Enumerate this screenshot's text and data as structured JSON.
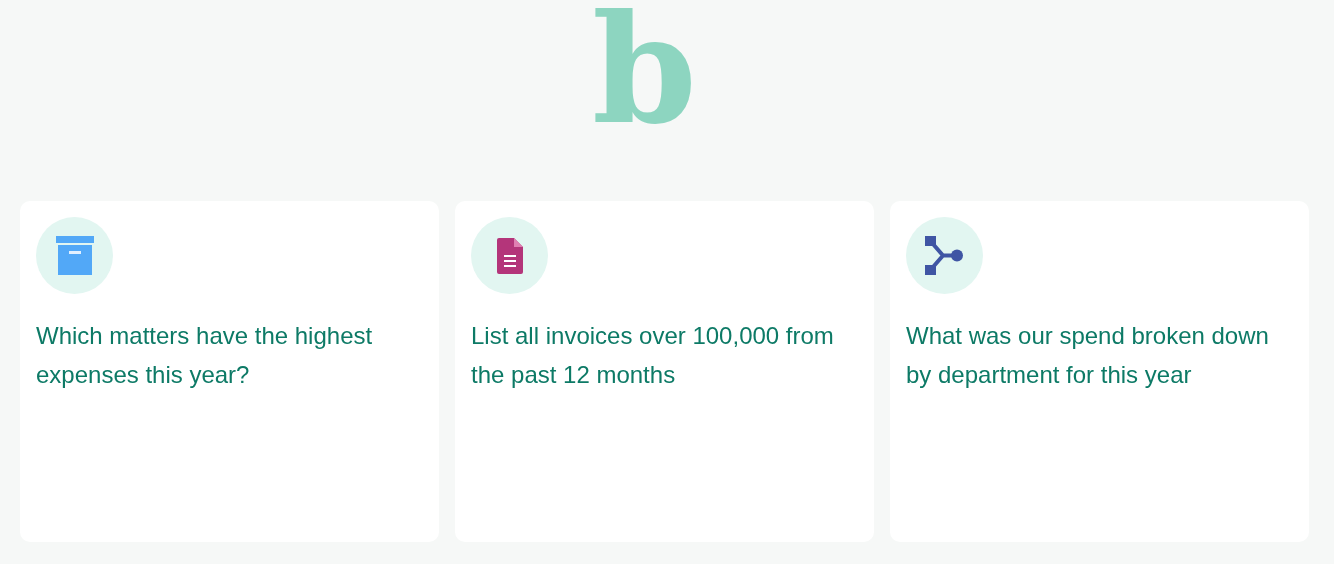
{
  "logo": {
    "text": "b"
  },
  "cards": [
    {
      "kind": "archive",
      "text": "Which matters have the highest expenses this year?"
    },
    {
      "kind": "document",
      "text": "List all invoices over 100,000 from the past 12 months"
    },
    {
      "kind": "merge",
      "text": "What was our spend broken down by department for this year"
    }
  ]
}
